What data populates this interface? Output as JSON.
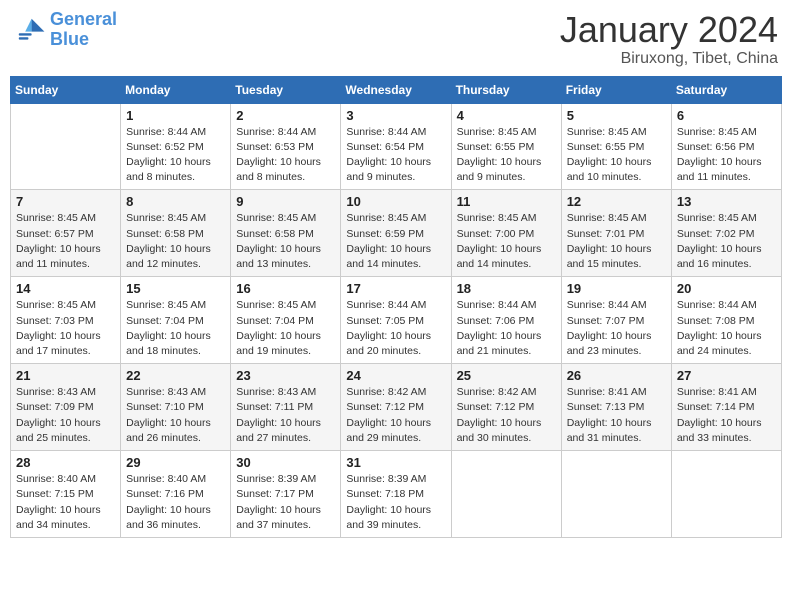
{
  "logo": {
    "line1": "General",
    "line2": "Blue"
  },
  "title": "January 2024",
  "location": "Biruxong, Tibet, China",
  "days_of_week": [
    "Sunday",
    "Monday",
    "Tuesday",
    "Wednesday",
    "Thursday",
    "Friday",
    "Saturday"
  ],
  "weeks": [
    [
      {
        "day": "",
        "sunrise": "",
        "sunset": "",
        "daylight": ""
      },
      {
        "day": "1",
        "sunrise": "Sunrise: 8:44 AM",
        "sunset": "Sunset: 6:52 PM",
        "daylight": "Daylight: 10 hours and 8 minutes."
      },
      {
        "day": "2",
        "sunrise": "Sunrise: 8:44 AM",
        "sunset": "Sunset: 6:53 PM",
        "daylight": "Daylight: 10 hours and 8 minutes."
      },
      {
        "day": "3",
        "sunrise": "Sunrise: 8:44 AM",
        "sunset": "Sunset: 6:54 PM",
        "daylight": "Daylight: 10 hours and 9 minutes."
      },
      {
        "day": "4",
        "sunrise": "Sunrise: 8:45 AM",
        "sunset": "Sunset: 6:55 PM",
        "daylight": "Daylight: 10 hours and 9 minutes."
      },
      {
        "day": "5",
        "sunrise": "Sunrise: 8:45 AM",
        "sunset": "Sunset: 6:55 PM",
        "daylight": "Daylight: 10 hours and 10 minutes."
      },
      {
        "day": "6",
        "sunrise": "Sunrise: 8:45 AM",
        "sunset": "Sunset: 6:56 PM",
        "daylight": "Daylight: 10 hours and 11 minutes."
      }
    ],
    [
      {
        "day": "7",
        "sunrise": "Sunrise: 8:45 AM",
        "sunset": "Sunset: 6:57 PM",
        "daylight": "Daylight: 10 hours and 11 minutes."
      },
      {
        "day": "8",
        "sunrise": "Sunrise: 8:45 AM",
        "sunset": "Sunset: 6:58 PM",
        "daylight": "Daylight: 10 hours and 12 minutes."
      },
      {
        "day": "9",
        "sunrise": "Sunrise: 8:45 AM",
        "sunset": "Sunset: 6:58 PM",
        "daylight": "Daylight: 10 hours and 13 minutes."
      },
      {
        "day": "10",
        "sunrise": "Sunrise: 8:45 AM",
        "sunset": "Sunset: 6:59 PM",
        "daylight": "Daylight: 10 hours and 14 minutes."
      },
      {
        "day": "11",
        "sunrise": "Sunrise: 8:45 AM",
        "sunset": "Sunset: 7:00 PM",
        "daylight": "Daylight: 10 hours and 14 minutes."
      },
      {
        "day": "12",
        "sunrise": "Sunrise: 8:45 AM",
        "sunset": "Sunset: 7:01 PM",
        "daylight": "Daylight: 10 hours and 15 minutes."
      },
      {
        "day": "13",
        "sunrise": "Sunrise: 8:45 AM",
        "sunset": "Sunset: 7:02 PM",
        "daylight": "Daylight: 10 hours and 16 minutes."
      }
    ],
    [
      {
        "day": "14",
        "sunrise": "Sunrise: 8:45 AM",
        "sunset": "Sunset: 7:03 PM",
        "daylight": "Daylight: 10 hours and 17 minutes."
      },
      {
        "day": "15",
        "sunrise": "Sunrise: 8:45 AM",
        "sunset": "Sunset: 7:04 PM",
        "daylight": "Daylight: 10 hours and 18 minutes."
      },
      {
        "day": "16",
        "sunrise": "Sunrise: 8:45 AM",
        "sunset": "Sunset: 7:04 PM",
        "daylight": "Daylight: 10 hours and 19 minutes."
      },
      {
        "day": "17",
        "sunrise": "Sunrise: 8:44 AM",
        "sunset": "Sunset: 7:05 PM",
        "daylight": "Daylight: 10 hours and 20 minutes."
      },
      {
        "day": "18",
        "sunrise": "Sunrise: 8:44 AM",
        "sunset": "Sunset: 7:06 PM",
        "daylight": "Daylight: 10 hours and 21 minutes."
      },
      {
        "day": "19",
        "sunrise": "Sunrise: 8:44 AM",
        "sunset": "Sunset: 7:07 PM",
        "daylight": "Daylight: 10 hours and 23 minutes."
      },
      {
        "day": "20",
        "sunrise": "Sunrise: 8:44 AM",
        "sunset": "Sunset: 7:08 PM",
        "daylight": "Daylight: 10 hours and 24 minutes."
      }
    ],
    [
      {
        "day": "21",
        "sunrise": "Sunrise: 8:43 AM",
        "sunset": "Sunset: 7:09 PM",
        "daylight": "Daylight: 10 hours and 25 minutes."
      },
      {
        "day": "22",
        "sunrise": "Sunrise: 8:43 AM",
        "sunset": "Sunset: 7:10 PM",
        "daylight": "Daylight: 10 hours and 26 minutes."
      },
      {
        "day": "23",
        "sunrise": "Sunrise: 8:43 AM",
        "sunset": "Sunset: 7:11 PM",
        "daylight": "Daylight: 10 hours and 27 minutes."
      },
      {
        "day": "24",
        "sunrise": "Sunrise: 8:42 AM",
        "sunset": "Sunset: 7:12 PM",
        "daylight": "Daylight: 10 hours and 29 minutes."
      },
      {
        "day": "25",
        "sunrise": "Sunrise: 8:42 AM",
        "sunset": "Sunset: 7:12 PM",
        "daylight": "Daylight: 10 hours and 30 minutes."
      },
      {
        "day": "26",
        "sunrise": "Sunrise: 8:41 AM",
        "sunset": "Sunset: 7:13 PM",
        "daylight": "Daylight: 10 hours and 31 minutes."
      },
      {
        "day": "27",
        "sunrise": "Sunrise: 8:41 AM",
        "sunset": "Sunset: 7:14 PM",
        "daylight": "Daylight: 10 hours and 33 minutes."
      }
    ],
    [
      {
        "day": "28",
        "sunrise": "Sunrise: 8:40 AM",
        "sunset": "Sunset: 7:15 PM",
        "daylight": "Daylight: 10 hours and 34 minutes."
      },
      {
        "day": "29",
        "sunrise": "Sunrise: 8:40 AM",
        "sunset": "Sunset: 7:16 PM",
        "daylight": "Daylight: 10 hours and 36 minutes."
      },
      {
        "day": "30",
        "sunrise": "Sunrise: 8:39 AM",
        "sunset": "Sunset: 7:17 PM",
        "daylight": "Daylight: 10 hours and 37 minutes."
      },
      {
        "day": "31",
        "sunrise": "Sunrise: 8:39 AM",
        "sunset": "Sunset: 7:18 PM",
        "daylight": "Daylight: 10 hours and 39 minutes."
      },
      {
        "day": "",
        "sunrise": "",
        "sunset": "",
        "daylight": ""
      },
      {
        "day": "",
        "sunrise": "",
        "sunset": "",
        "daylight": ""
      },
      {
        "day": "",
        "sunrise": "",
        "sunset": "",
        "daylight": ""
      }
    ]
  ]
}
